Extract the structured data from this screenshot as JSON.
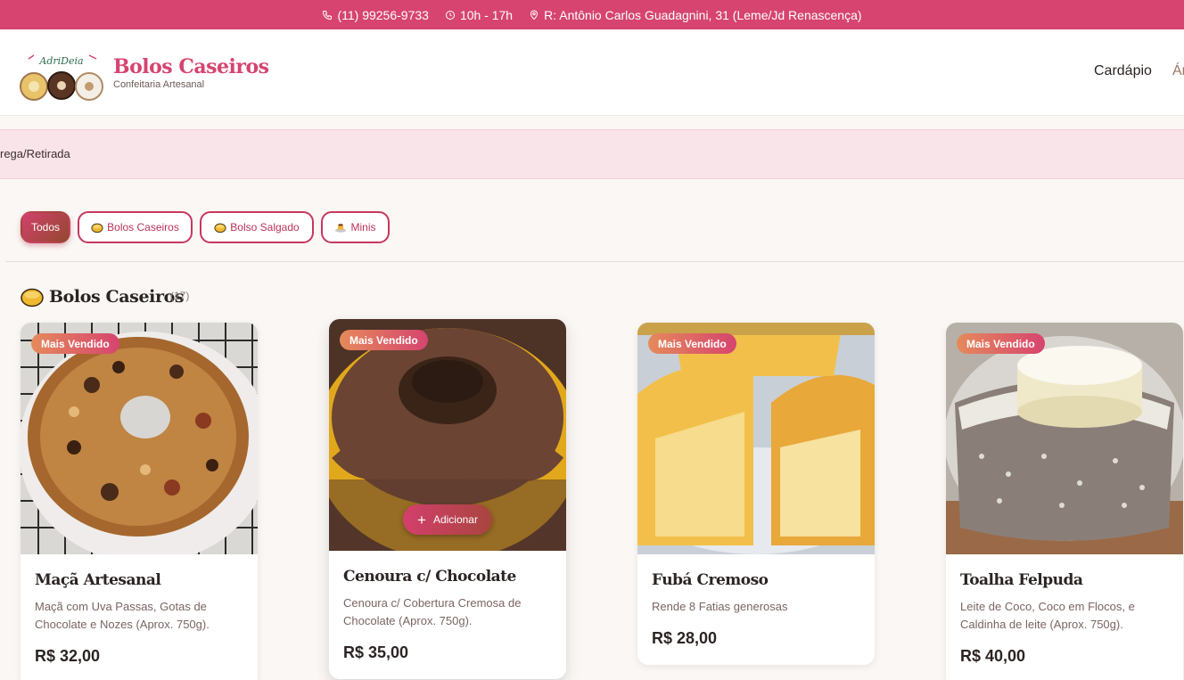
{
  "topbar": {
    "phone": "(11) 99256-9733",
    "hours": "10h - 17h",
    "address": "R: Antônio Carlos Guadagnini, 31 (Leme/Jd Renascença)"
  },
  "header": {
    "logo_text": "AdriDeia",
    "brand_title": "Bolos Caseiros",
    "brand_subtitle": "Confeitaria Artesanal",
    "nav": [
      "Cardápio",
      "Ár"
    ]
  },
  "banner": {
    "text": "rega/Retirada"
  },
  "filters": [
    {
      "label": "Todos",
      "icon": "",
      "active": true
    },
    {
      "label": "Bolos Caseiros",
      "icon": "cake-icon",
      "active": false
    },
    {
      "label": "Bolso Salgado",
      "icon": "cake-icon",
      "active": false
    },
    {
      "label": "Minis",
      "icon": "pudding-icon",
      "active": false
    }
  ],
  "section": {
    "title": "Bolos Caseiros",
    "count": "(17)",
    "icon": "cake-icon"
  },
  "products": [
    {
      "badge": "Mais Vendido",
      "name": "Maçã Artesanal",
      "description": "Maçã com Uva Passas, Gotas de Chocolate e Nozes (Aprox. 750g).",
      "price": "R$ 32,00"
    },
    {
      "badge": "Mais Vendido",
      "name": "Cenoura c/ Chocolate",
      "description": "Cenoura c/ Cobertura Cremosa de Chocolate (Aprox. 750g).",
      "price": "R$ 35,00",
      "add_label": "Adicionar"
    },
    {
      "badge": "Mais Vendido",
      "name": "Fubá Cremoso",
      "description": "Rende 8 Fatias generosas",
      "price": "R$ 28,00"
    },
    {
      "badge": "Mais Vendido",
      "name": "Toalha Felpuda",
      "description": "Leite de Coco, Coco em Flocos, e Caldinha de leite (Aprox. 750g).",
      "price": "R$ 40,00"
    }
  ],
  "colors": {
    "brand": "#d6446f",
    "banner": "#f9e4ea",
    "text": "#2b2422"
  }
}
